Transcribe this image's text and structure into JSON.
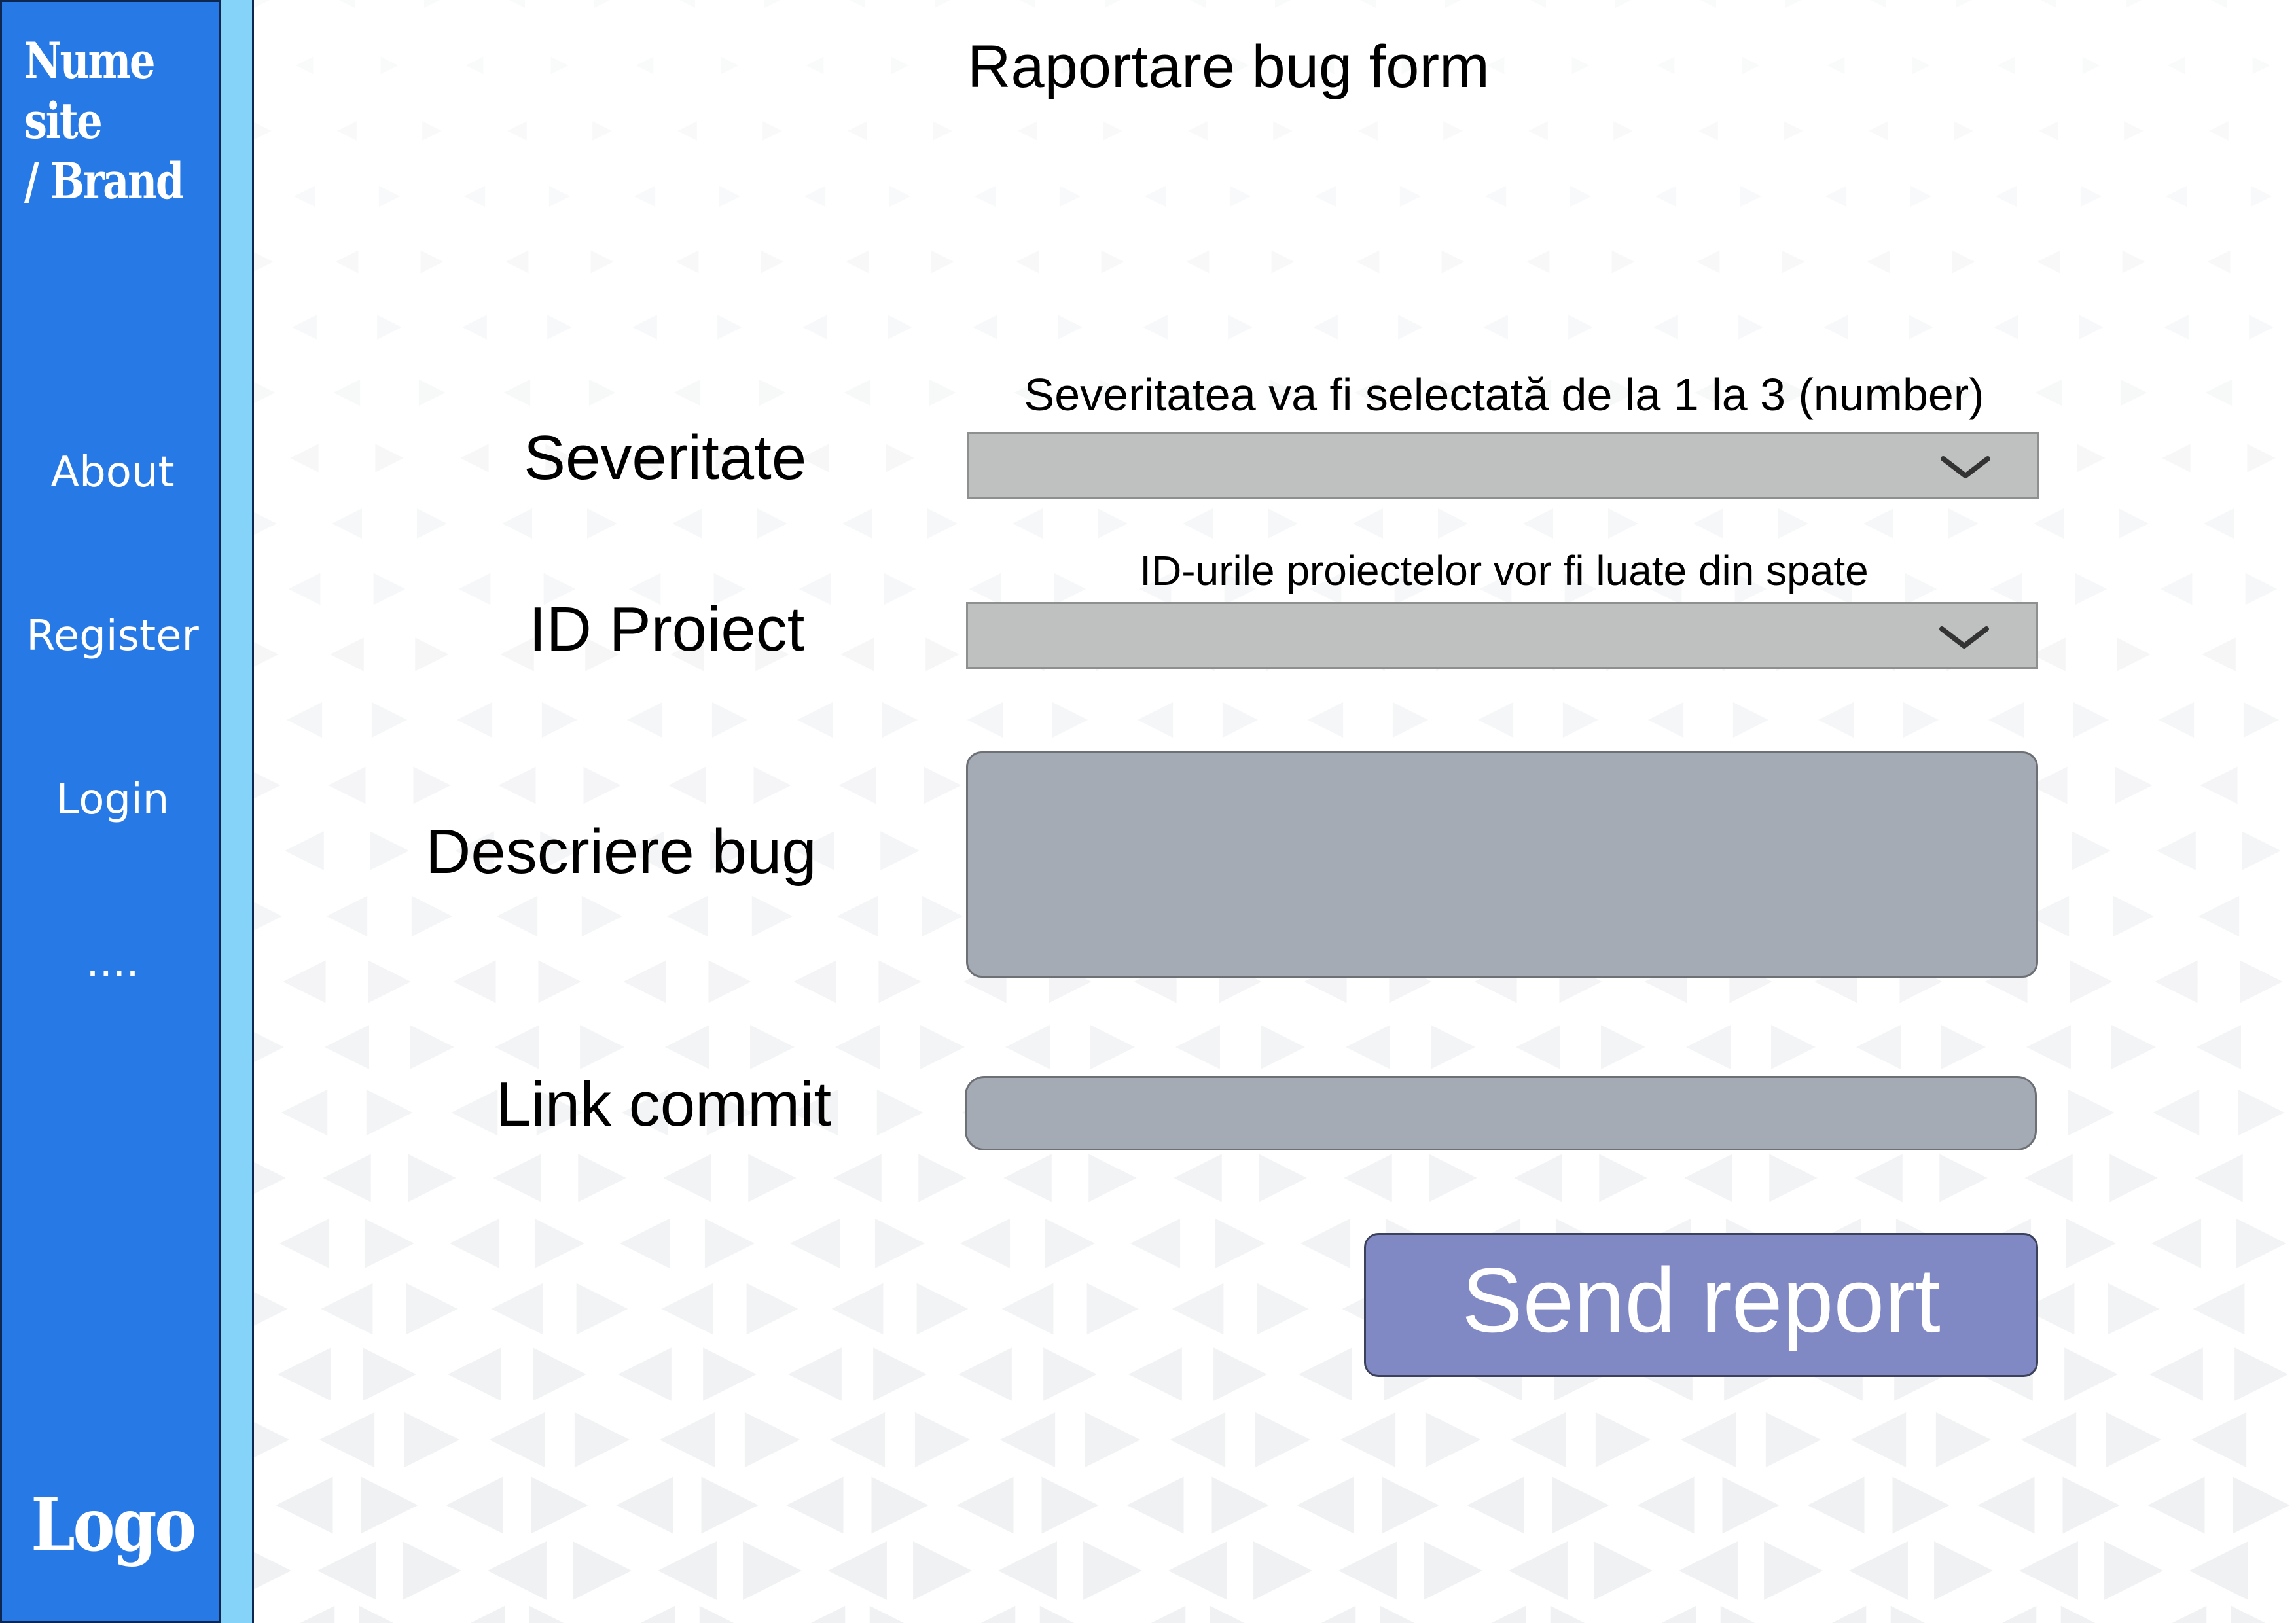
{
  "sidebar": {
    "brand": "Nume site / Brand",
    "brand_line1": "Nume site",
    "brand_line2": "/ Brand",
    "items": [
      {
        "label": "About"
      },
      {
        "label": "Register"
      },
      {
        "label": "Login"
      },
      {
        "label": "...."
      }
    ],
    "logo": "Logo"
  },
  "main": {
    "title": "Raportare bug form",
    "fields": {
      "severity": {
        "label": "Severitate",
        "hint": "Severitatea va fi selectată de la 1 la 3 (number)",
        "value": ""
      },
      "project_id": {
        "label": "ID Proiect",
        "hint": "ID-urile proiectelor vor fi luate din spate",
        "value": ""
      },
      "description": {
        "label": "Descriere bug",
        "value": ""
      },
      "commit_link": {
        "label": "Link commit",
        "value": ""
      }
    },
    "submit_label": "Send report"
  },
  "icons": {
    "select_chevron": "chevron-down-icon"
  },
  "colors": {
    "sidebar_bg": "#277ae6",
    "sidebar_strip": "#86d3fa",
    "select_bg": "#bfc1c1",
    "input_bg": "#a5abb4",
    "button_bg": "#8189c4"
  }
}
